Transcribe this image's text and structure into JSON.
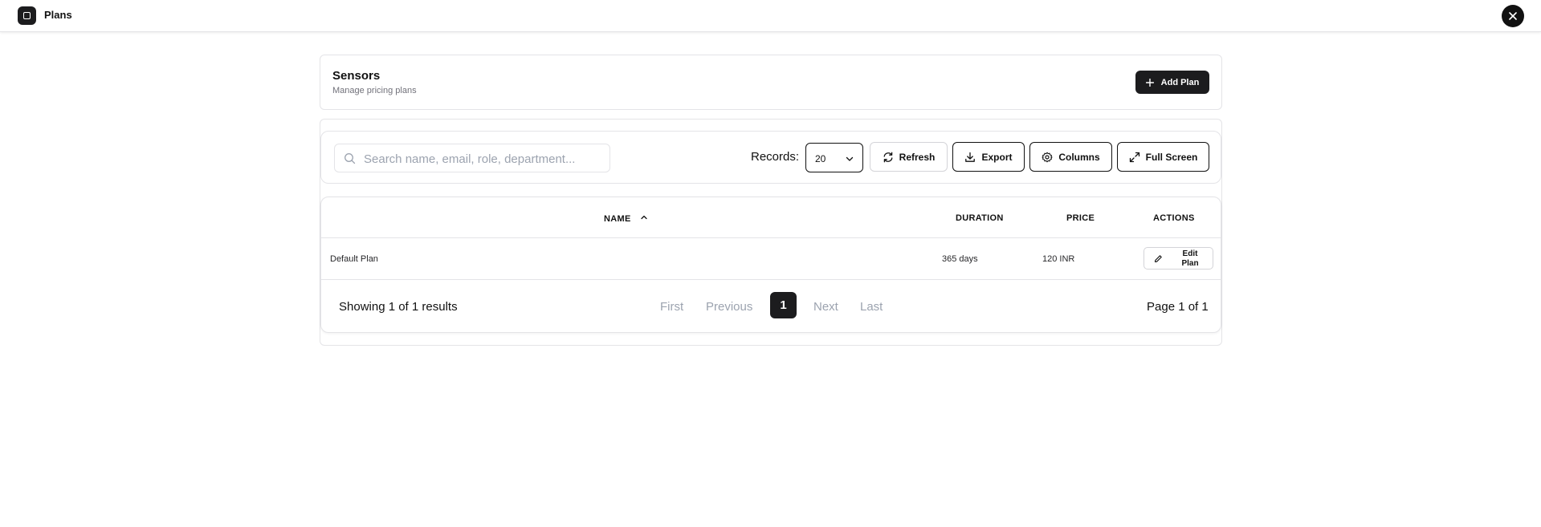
{
  "window": {
    "title": "Plans"
  },
  "header": {
    "title": "Sensors",
    "subtitle": "Manage pricing plans",
    "add_button_label": "Add Plan"
  },
  "toolbar": {
    "search_placeholder": "Search name, email, role, department...",
    "search_value": "",
    "records_label": "Records:",
    "records_value": "20",
    "refresh_label": "Refresh",
    "export_label": "Export",
    "columns_label": "Columns",
    "fullscreen_label": "Full Screen"
  },
  "table": {
    "columns": [
      {
        "key": "name",
        "label": "NAME",
        "sort": "ascending"
      },
      {
        "key": "duration",
        "label": "DURATION"
      },
      {
        "key": "price",
        "label": "PRICE"
      },
      {
        "key": "actions",
        "label": "ACTIONS"
      }
    ],
    "rows": [
      {
        "name": "Default Plan",
        "duration": "365 days",
        "price": "120 INR",
        "action_label": "Edit Plan"
      }
    ]
  },
  "pagination": {
    "summary": "Showing 1 of 1 results",
    "first": "First",
    "previous": "Previous",
    "current_page": "1",
    "next": "Next",
    "last": "Last",
    "page_info": "Page 1 of 1"
  },
  "icons": {
    "app": "app-square-icon",
    "close": "close-icon",
    "add": "plus-icon",
    "search": "search-icon",
    "select": "chevron-down-icon",
    "refresh": "refresh-icon",
    "export": "download-icon",
    "columns": "gear-icon",
    "fullscreen": "expand-icon",
    "sort": "chevron-up-icon",
    "edit": "pencil-icon"
  },
  "colors": {
    "primary": "#1c1c1e",
    "border": "#e4e4e7",
    "muted_text": "#71717a",
    "disabled_text": "#9ca3af"
  }
}
